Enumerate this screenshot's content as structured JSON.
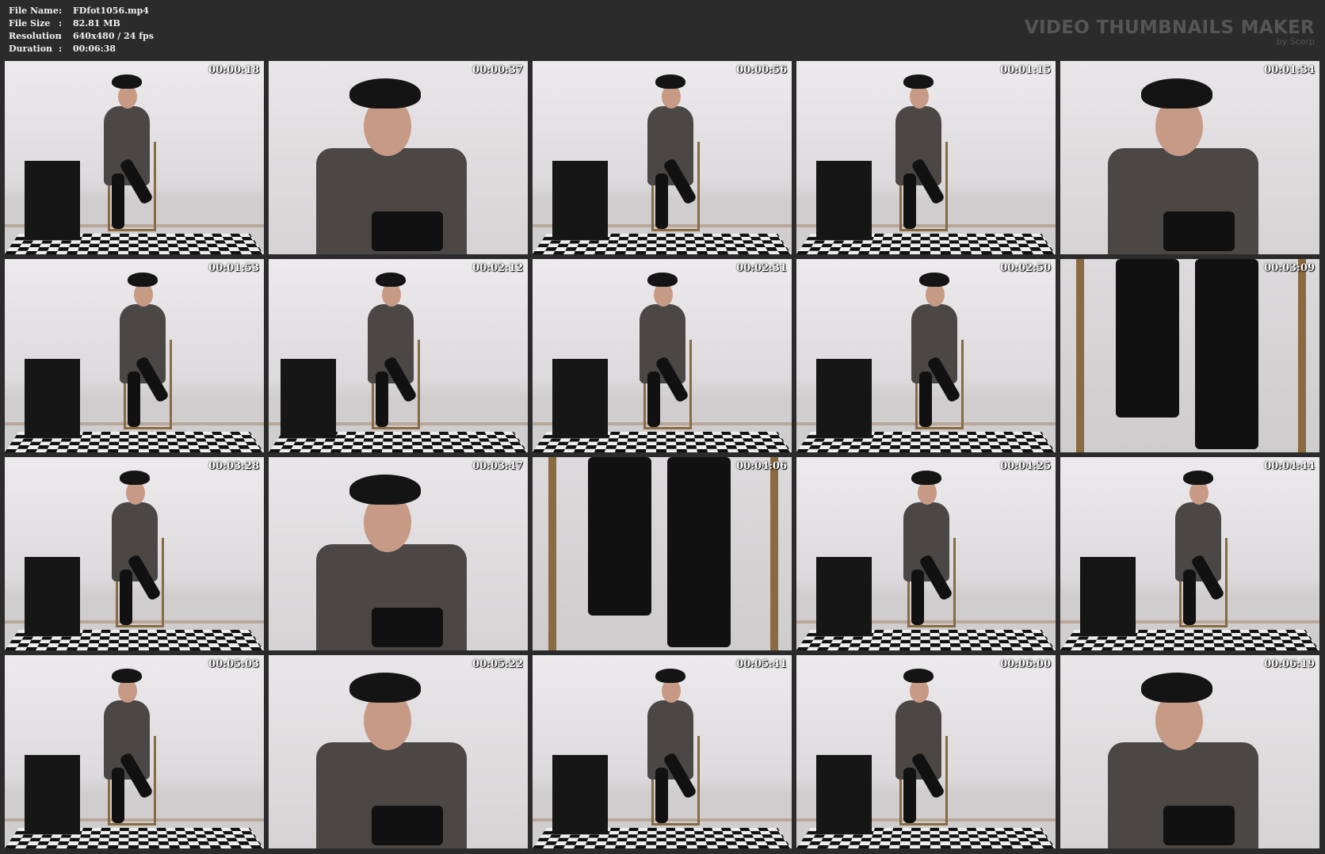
{
  "header": {
    "file_name_label": "File Name",
    "file_name": "FDfot1056.mp4",
    "file_size_label": "File Size",
    "file_size": "82.81 MB",
    "resolution_label": "Resolution",
    "resolution": "640x480 / 24 fps",
    "duration_label": "Duration",
    "duration": "00:06:38",
    "separator": ":",
    "brand_title": "VIDEO THUMBNAILS MAKER",
    "brand_sub": "by Scorp"
  },
  "thumbnails": [
    {
      "timestamp": "00:00:18"
    },
    {
      "timestamp": "00:00:37"
    },
    {
      "timestamp": "00:00:56"
    },
    {
      "timestamp": "00:01:15"
    },
    {
      "timestamp": "00:01:34"
    },
    {
      "timestamp": "00:01:53"
    },
    {
      "timestamp": "00:02:12"
    },
    {
      "timestamp": "00:02:31"
    },
    {
      "timestamp": "00:02:50"
    },
    {
      "timestamp": "00:03:09"
    },
    {
      "timestamp": "00:03:28"
    },
    {
      "timestamp": "00:03:47"
    },
    {
      "timestamp": "00:04:06"
    },
    {
      "timestamp": "00:04:25"
    },
    {
      "timestamp": "00:04:44"
    },
    {
      "timestamp": "00:05:03"
    },
    {
      "timestamp": "00:05:22"
    },
    {
      "timestamp": "00:05:41"
    },
    {
      "timestamp": "00:06:00"
    },
    {
      "timestamp": "00:06:19"
    }
  ]
}
